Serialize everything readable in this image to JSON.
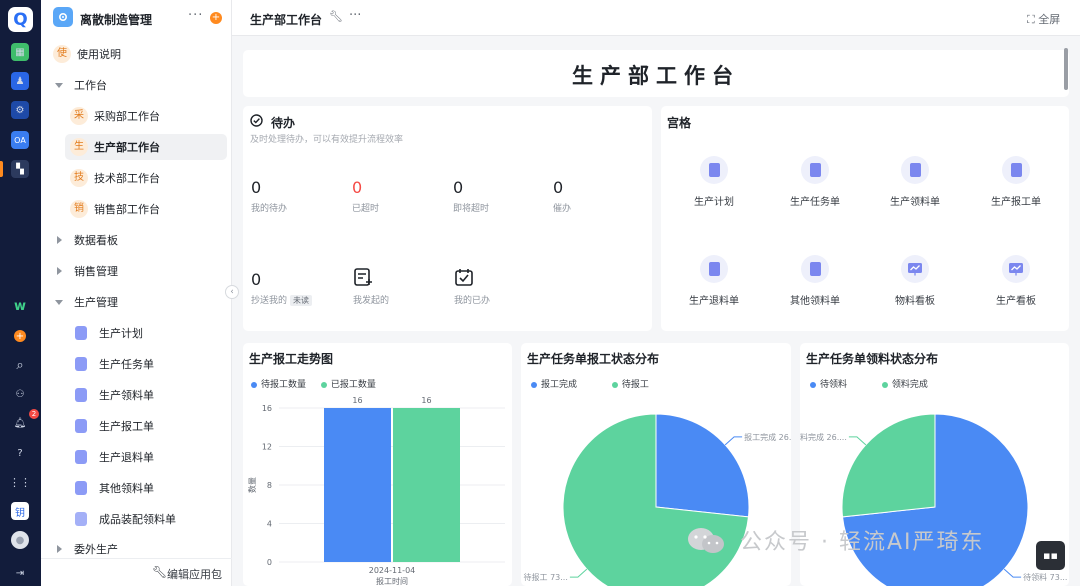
{
  "sidebar": {
    "app_title": "离散制造管理",
    "more": "···",
    "items": [
      {
        "char": "使",
        "label": "使用说明"
      },
      {
        "label": "工作台"
      },
      {
        "char": "采",
        "label": "采购部工作台"
      },
      {
        "char": "生",
        "label": "生产部工作台",
        "active": true
      },
      {
        "char": "技",
        "label": "技术部工作台"
      },
      {
        "char": "销",
        "label": "销售部工作台"
      },
      {
        "label": "数据看板"
      },
      {
        "label": "销售管理"
      },
      {
        "label": "生产管理"
      },
      {
        "label": "生产计划"
      },
      {
        "label": "生产任务单"
      },
      {
        "label": "生产领料单"
      },
      {
        "label": "生产报工单"
      },
      {
        "label": "生产退料单"
      },
      {
        "label": "其他领料单"
      },
      {
        "label": "成品装配领料单"
      },
      {
        "label": "委外生产"
      }
    ],
    "footer": "编辑应用包"
  },
  "rail": {
    "notification_badge": "2",
    "oa_label": "OA"
  },
  "topbar": {
    "title": "生产部工作台",
    "more": "···",
    "fullscreen": "全屏"
  },
  "banner": {
    "title": "生产部工作台"
  },
  "todo": {
    "title": "待办",
    "subtitle": "及时处理待办，可以有效提升流程效率",
    "stats": [
      {
        "value": "0",
        "label": "我的待办"
      },
      {
        "value": "0",
        "label": "已超时"
      },
      {
        "value": "0",
        "label": "即将超时"
      },
      {
        "value": "0",
        "label": "催办"
      },
      {
        "value": "0",
        "label": "抄送我的",
        "tag": "未读"
      }
    ],
    "quick": [
      {
        "label": "我发起的"
      },
      {
        "label": "我的已办"
      }
    ]
  },
  "palace": {
    "title": "宫格",
    "items": [
      "生产计划",
      "生产任务单",
      "生产领料单",
      "生产报工单",
      "生产退料单",
      "其他领料单",
      "物料看板",
      "生产看板"
    ]
  },
  "charts": {
    "c1_title": "生产报工走势图",
    "c2_title": "生产任务单报工状态分布",
    "c3_title": "生产任务单领料状态分布"
  },
  "chart_data": [
    {
      "type": "bar",
      "title": "生产报工走势图",
      "categories": [
        "2024-11-04"
      ],
      "series": [
        {
          "name": "待报工数量",
          "values": [
            16
          ],
          "color": "#4a8af4"
        },
        {
          "name": "已报工数量",
          "values": [
            16
          ],
          "color": "#5dd39e"
        }
      ],
      "xlabel": "报工时间",
      "ylabel": "数量",
      "ylim": [
        0,
        16
      ],
      "yticks": [
        "0",
        "4",
        "8",
        "12",
        "16"
      ],
      "grid": true
    },
    {
      "type": "pie",
      "title": "生产任务单报工状态分布",
      "slices": [
        {
          "name": "报工完成",
          "value": 26.7,
          "color": "#4a8af4",
          "label": "报工完成 26...."
        },
        {
          "name": "待报工",
          "value": 73.3,
          "color": "#5dd39e",
          "label": "待报工 73..."
        }
      ]
    },
    {
      "type": "pie",
      "title": "生产任务单领料状态分布",
      "slices": [
        {
          "name": "待领料",
          "value": 73.3,
          "color": "#4a8af4",
          "label": "待领料 73..."
        },
        {
          "name": "领料完成",
          "value": 26.7,
          "color": "#5dd39e",
          "label": "领料完成 26...."
        }
      ]
    }
  ],
  "watermark": "公众号 · 轻流AI严琦东"
}
